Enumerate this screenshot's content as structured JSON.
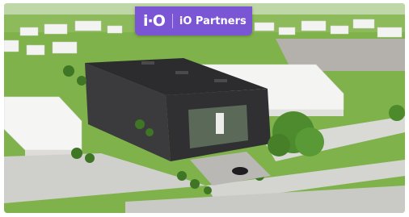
{
  "brand": {
    "mark": "i·O",
    "name": "iO Partners",
    "badge_color": "#7b56d4"
  },
  "scene": {
    "subject": "aerial-rendering",
    "colors": {
      "grass": "#6aa437",
      "building_roof": "#2e2e30",
      "building_wall": "#3a3a3c",
      "white_block": "#f1f1f1",
      "road": "#d6d6d4",
      "sky_haze": "#e9ece6"
    }
  }
}
